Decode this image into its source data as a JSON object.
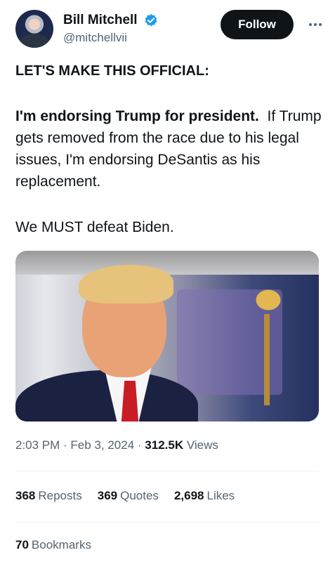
{
  "author": {
    "name": "Bill Mitchell",
    "handle": "@mitchellvii",
    "verified_color": "#1d9bf0"
  },
  "actions": {
    "follow_label": "Follow",
    "more_icon": "more-dots-icon"
  },
  "tweet": {
    "line1": "LET'S MAKE THIS OFFICIAL:",
    "bold_part": "I'm endorsing Trump for president.",
    "rest": "If Trump gets removed from the race due to his legal issues, I'm endorsing DeSantis as his replacement.",
    "final": "We MUST defeat Biden."
  },
  "meta": {
    "time": "2:03 PM",
    "sep1": " · ",
    "date": "Feb 3, 2024",
    "sep2": " · ",
    "views_count": "312.5K",
    "views_label": "Views"
  },
  "stats": {
    "reposts_count": "368",
    "reposts_label": "Reposts",
    "quotes_count": "369",
    "quotes_label": "Quotes",
    "likes_count": "2,698",
    "likes_label": "Likes",
    "bookmarks_count": "70",
    "bookmarks_label": "Bookmarks"
  }
}
